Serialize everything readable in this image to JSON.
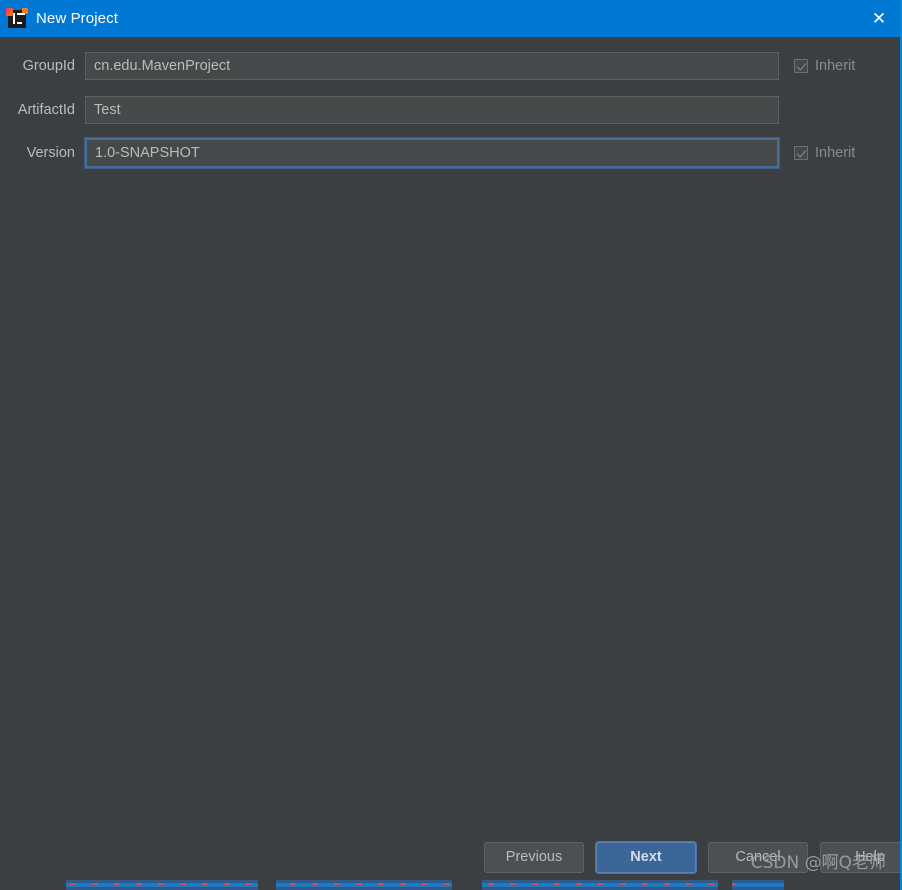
{
  "titlebar": {
    "title": "New Project",
    "app_icon": "intellij-idea-icon",
    "close_icon": "✕",
    "background_color": "#0078D4"
  },
  "form": {
    "fields": [
      {
        "label": "GroupId",
        "value": "cn.edu.MavenProject",
        "focused": false,
        "inherit": {
          "label": "Inherit",
          "checked": true,
          "disabled": true
        }
      },
      {
        "label": "ArtifactId",
        "value": "Test",
        "focused": false,
        "inherit": null
      },
      {
        "label": "Version",
        "value": "1.0-SNAPSHOT",
        "focused": true,
        "inherit": {
          "label": "Inherit",
          "checked": true,
          "disabled": true
        }
      }
    ]
  },
  "buttons": {
    "previous": "Previous",
    "next": "Next",
    "cancel": "Cancel",
    "help": "Help",
    "default_button": "Next",
    "default_color": "#3C6598"
  },
  "watermark": {
    "text": "CSDN @啊Q老师"
  },
  "theme": {
    "dialog_background": "#3C3F41",
    "input_background": "#45494A",
    "text_color": "#BBBBBB",
    "focus_border": "#466D94"
  }
}
